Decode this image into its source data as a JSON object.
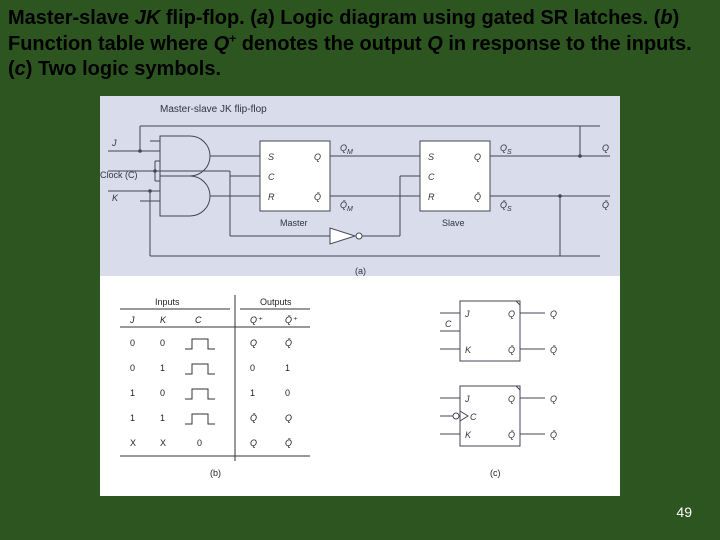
{
  "heading": {
    "prefix": "Master-slave ",
    "ital1": "JK",
    "mid1": " flip-flop. (",
    "ital2": "a",
    "mid2": ") Logic diagram using gated SR latches. (",
    "ital3": "b",
    "mid3": ") Function table where ",
    "ital4": "Q",
    "sup": "+",
    "mid4": " denotes the output ",
    "ital5": "Q",
    "mid5": " in response to the inputs. (",
    "ital6": "c",
    "mid6": ") Two logic symbols."
  },
  "diagramA": {
    "title": "Master-slave JK flip-flop",
    "inputs": {
      "j": "J",
      "k": "K",
      "clock": "Clock (C)"
    },
    "master": {
      "label": "Master",
      "s": "S",
      "c": "C",
      "r": "R",
      "q": "Q",
      "qbar": "Q̄",
      "qM": "M",
      "qMq": "Q"
    },
    "slave": {
      "label": "Slave",
      "s": "S",
      "c": "C",
      "r": "R",
      "q": "Q",
      "qbar": "Q̄",
      "qS": "S"
    },
    "outputs": {
      "q": "Q",
      "qbar": "Q̄"
    },
    "captionTag": "(a)"
  },
  "tableB": {
    "captionTag": "(b)",
    "headerGroups": {
      "inputs": "Inputs",
      "outputs": "Outputs"
    },
    "cols": [
      "J",
      "K",
      "C",
      "Q⁺",
      "Q̄⁺"
    ],
    "rows": [
      {
        "j": "0",
        "k": "0",
        "c": "pulse",
        "q": "Q",
        "qb": "Q̄"
      },
      {
        "j": "0",
        "k": "1",
        "c": "pulse",
        "q": "0",
        "qb": "1"
      },
      {
        "j": "1",
        "k": "0",
        "c": "pulse",
        "q": "1",
        "qb": "0"
      },
      {
        "j": "1",
        "k": "1",
        "c": "pulse",
        "q": "Q̄",
        "qb": "Q"
      },
      {
        "j": "X",
        "k": "X",
        "c": "0",
        "q": "Q",
        "qb": "Q̄"
      }
    ]
  },
  "symbolsC": {
    "captionTag": "(c)",
    "top": {
      "j": "J",
      "c": "C",
      "k": "K",
      "q": "Q",
      "qb": "Q̄"
    },
    "bot": {
      "j": "J",
      "c": "C",
      "k": "K",
      "q": "Q",
      "qb": "Q̄"
    }
  },
  "slideNumber": "49"
}
